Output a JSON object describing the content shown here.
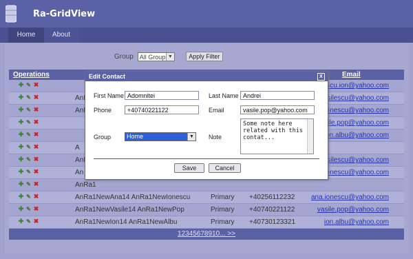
{
  "app": {
    "title": "Ra-GridView"
  },
  "nav": {
    "home": "Home",
    "about": "About"
  },
  "filter": {
    "label": "Group",
    "selected": "All Groups",
    "button": "Apply Filter"
  },
  "grid": {
    "headers": {
      "operations": "Operations",
      "email": "Email"
    },
    "rows": [
      {
        "name": "",
        "group": "",
        "phone": "",
        "email": "escu.ion@yahoo.com"
      },
      {
        "name": "AnRa1",
        "group": "",
        "phone": "",
        "email": "e.vasilescu@yahoo.com"
      },
      {
        "name": "AnRa",
        "group": "",
        "phone": "",
        "email": "ionescu@yahoo.com"
      },
      {
        "name": "",
        "group": "",
        "phone": "",
        "email": "sile.pop@yahoo.com"
      },
      {
        "name": "",
        "group": "",
        "phone": "",
        "email": "on.albu@yahoo.com"
      },
      {
        "name": "A",
        "group": "",
        "phone": "",
        "email": ""
      },
      {
        "name": "AnRa1N",
        "group": "",
        "phone": "",
        "email": "ne.vasilescu@yahoo.com"
      },
      {
        "name": "An",
        "group": "",
        "phone": "",
        "email": "ionescu@yahoo.com"
      },
      {
        "name": "AnRa1",
        "group": "",
        "phone": "",
        "email": ""
      },
      {
        "name": "AnRa1NewAna14 AnRa1NewIonescu",
        "group": "Primary",
        "phone": "+40256112232",
        "email": "ana.ionescu@yahoo.com"
      },
      {
        "name": "AnRa1NewVasile14 AnRa1NewPop",
        "group": "Primary",
        "phone": "+40740221122",
        "email": "vasile.pop@yahoo.com"
      },
      {
        "name": "AnRa1NewIon14 AnRa1NewAlbu",
        "group": "Primary",
        "phone": "+40730123321",
        "email": "ion.albu@yahoo.com"
      }
    ],
    "pager": {
      "pages": "12345678910",
      "next": " >>",
      "more": "..."
    }
  },
  "dialog": {
    "title": "Edit Contact",
    "close": "X",
    "first_name_label": "First Name",
    "first_name": "Adomnitei",
    "last_name_label": "Last Name",
    "last_name": "Andrei",
    "phone_label": "Phone",
    "phone": "+40740221122",
    "email_label": "Email",
    "email": "vasile.pop@yahoo.com",
    "group_label": "Group",
    "group": "Home",
    "note_label": "Note",
    "note": "Some note here\nrelated with this\ncontat...",
    "save": "Save",
    "cancel": "Cancel"
  },
  "colors": {
    "header": "#5a61a4",
    "nav": "#4a5192",
    "link": "#2233aa",
    "add": "#2e8b2e",
    "delete": "#cc2222"
  }
}
